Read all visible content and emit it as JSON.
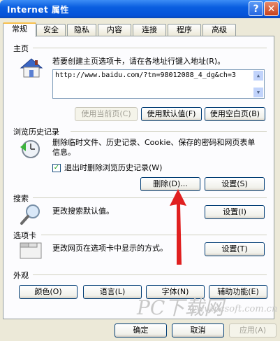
{
  "window": {
    "title": "Internet 属性",
    "help_glyph": "?",
    "close_glyph": "✕"
  },
  "tabs": [
    "常规",
    "安全",
    "隐私",
    "内容",
    "连接",
    "程序",
    "高级"
  ],
  "home": {
    "label": "主页",
    "desc": "若要创建主页选项卡，请在各地址行键入地址(R)。",
    "url": "http://www.baidu.com/?tn=98012088_4_dg&ch=3",
    "use_current": "使用当前页(C)",
    "use_default": "使用默认值(F)",
    "use_blank": "使用空白页(B)"
  },
  "history": {
    "label": "浏览历史记录",
    "desc": "删除临时文件、历史记录、Cookie、保存的密码和网页表单信息。",
    "checkbox_label": "退出时删除浏览历史记录(W)",
    "checkbox_checked": true,
    "delete": "删除(D)...",
    "settings": "设置(S)"
  },
  "search": {
    "label": "搜索",
    "desc": "更改搜索默认值。",
    "settings": "设置(I)"
  },
  "tabs_section": {
    "label": "选项卡",
    "desc": "更改网页在选项卡中显示的方式。",
    "settings": "设置(T)"
  },
  "appearance": {
    "label": "外观",
    "colors": "颜色(O)",
    "languages": "语言(L)",
    "fonts": "字体(N)",
    "accessibility": "辅助功能(E)"
  },
  "footer": {
    "ok": "确定",
    "cancel": "取消",
    "apply": "应用(A)"
  },
  "watermark": {
    "line1": "PC下载网",
    "line2": "www.pcsoft.com.cn"
  },
  "colors": {
    "arrow": "#e02020",
    "titlebar": "#0a5ee0",
    "face": "#ece9d8"
  }
}
